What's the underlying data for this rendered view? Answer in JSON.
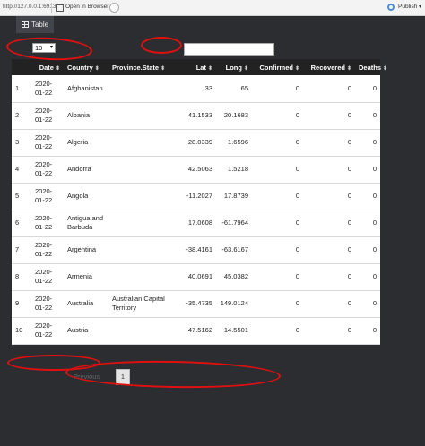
{
  "topbar": {
    "url": "http://127.0.0.1:6913",
    "open_browser": "Open in Browser",
    "publish": "Publish"
  },
  "tab": {
    "label": "Table"
  },
  "length_select": {
    "value": "10"
  },
  "table": {
    "columns": [
      "",
      "Date",
      "Country",
      "Province.State",
      "Lat",
      "Long",
      "Confirmed",
      "Recovered",
      "Deaths"
    ],
    "rows": [
      [
        "1",
        "2020-01-22",
        "Afghanistan",
        "",
        "33",
        "65",
        "0",
        "0",
        "0"
      ],
      [
        "2",
        "2020-01-22",
        "Albania",
        "",
        "41.1533",
        "20.1683",
        "0",
        "0",
        "0"
      ],
      [
        "3",
        "2020-01-22",
        "Algeria",
        "",
        "28.0339",
        "1.6596",
        "0",
        "0",
        "0"
      ],
      [
        "4",
        "2020-01-22",
        "Andorra",
        "",
        "42.5063",
        "1.5218",
        "0",
        "0",
        "0"
      ],
      [
        "5",
        "2020-01-22",
        "Angola",
        "",
        "-11.2027",
        "17.8739",
        "0",
        "0",
        "0"
      ],
      [
        "6",
        "2020-01-22",
        "Antigua and Barbuda",
        "",
        "17.0608",
        "-61.7964",
        "0",
        "0",
        "0"
      ],
      [
        "7",
        "2020-01-22",
        "Argentina",
        "",
        "-38.4161",
        "-63.6167",
        "0",
        "0",
        "0"
      ],
      [
        "8",
        "2020-01-22",
        "Armenia",
        "",
        "40.0691",
        "45.0382",
        "0",
        "0",
        "0"
      ],
      [
        "9",
        "2020-01-22",
        "Australia",
        "Australian Capital Territory",
        "-35.4735",
        "149.0124",
        "0",
        "0",
        "0"
      ],
      [
        "10",
        "2020-01-22",
        "Austria",
        "",
        "47.5162",
        "14.5501",
        "0",
        "0",
        "0"
      ]
    ]
  },
  "pagination": {
    "previous": "Previous",
    "current": "1"
  },
  "colors": {
    "background": "#2b2d31",
    "annotation": "#e01010",
    "header": "#222222"
  }
}
